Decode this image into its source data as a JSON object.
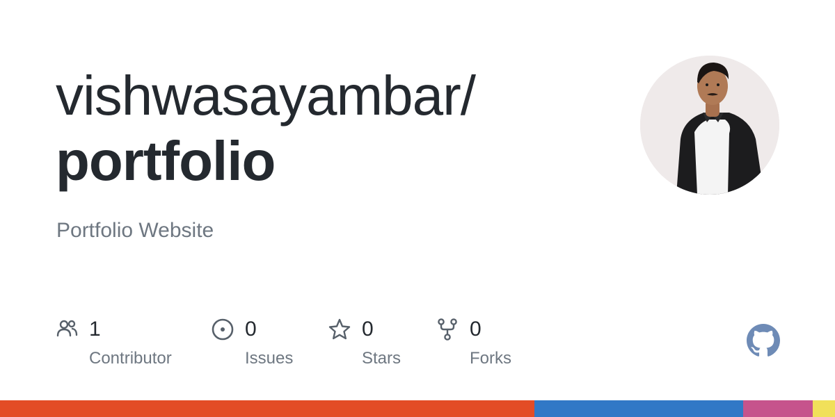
{
  "repo": {
    "owner": "vishwasayambar/",
    "name": "portfolio",
    "description": "Portfolio Website"
  },
  "stats": [
    {
      "count": "1",
      "label": "Contributor",
      "icon": "people-icon"
    },
    {
      "count": "0",
      "label": "Issues",
      "icon": "issue-opened-icon"
    },
    {
      "count": "0",
      "label": "Stars",
      "icon": "star-icon"
    },
    {
      "count": "0",
      "label": "Forks",
      "icon": "repo-forked-icon"
    }
  ],
  "colors": {
    "text": "#24292f",
    "muted": "#6e7781",
    "icon": "#57606a",
    "github_logo": "#6e8bb6"
  },
  "language_bar": [
    {
      "color": "#e34c26",
      "share": 0.64
    },
    {
      "color": "#3178c6",
      "share": 0.25
    },
    {
      "color": "#c6538c",
      "share": 0.083
    },
    {
      "color": "#f1e05a",
      "share": 0.027
    }
  ]
}
